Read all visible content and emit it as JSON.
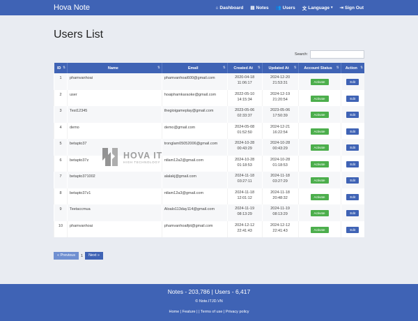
{
  "navbar": {
    "brand": "Hova Note",
    "items": [
      {
        "label": "Dashboard",
        "icon": "home-icon"
      },
      {
        "label": "Notes",
        "icon": "file-icon"
      },
      {
        "label": "Users",
        "icon": "users-icon"
      },
      {
        "label": "Language",
        "icon": "language-icon"
      },
      {
        "label": "Sign Out",
        "icon": "signout-icon"
      }
    ]
  },
  "page": {
    "title": "Users List"
  },
  "search": {
    "label": "Search:",
    "value": ""
  },
  "table": {
    "columns": [
      "ID",
      "Name",
      "Email",
      "Created At",
      "Updated At",
      "Account Status",
      "Action"
    ],
    "rows": [
      {
        "id": "1",
        "name": "phamvanhoai",
        "email": "phamvanhoai600@gmail.com",
        "created_date": "2020-04-18",
        "created_time": "11:06:17",
        "updated_date": "2024-12-20",
        "updated_time": "21:53:31",
        "status": "Activate",
        "action": "Edit"
      },
      {
        "id": "2",
        "name": "user",
        "email": "hoaiphamkaraoke@gmail.com",
        "created_date": "2022-05-10",
        "created_time": "14:15:34",
        "updated_date": "2024-12-19",
        "updated_time": "21:20:54",
        "status": "Activate",
        "action": "Edit"
      },
      {
        "id": "3",
        "name": "Test12345",
        "email": "thegioigameplay@gmail.com",
        "created_date": "2023-05-06",
        "created_time": "02:33:37",
        "updated_date": "2023-05-06",
        "updated_time": "17:50:39",
        "status": "Activate",
        "action": "Edit"
      },
      {
        "id": "4",
        "name": "demo",
        "email": "demo@gmail.com",
        "created_date": "2024-05-08",
        "created_time": "01:52:50",
        "updated_date": "2024-12-21",
        "updated_time": "16:22:54",
        "status": "Activate",
        "action": "Edit"
      },
      {
        "id": "5",
        "name": "betapto37",
        "email": "tronglam05052006@gmail.com",
        "created_date": "2024-10-28",
        "created_time": "00:43:29",
        "updated_date": "2024-10-28",
        "updated_time": "00:43:29",
        "status": "Activate",
        "action": "Edit"
      },
      {
        "id": "6",
        "name": "betapto37z",
        "email": "ntlam12a2@gmail.com",
        "created_date": "2024-10-28",
        "created_time": "01:18:53",
        "updated_date": "2024-10-28",
        "updated_time": "01:18:53",
        "status": "Activate",
        "action": "Edit"
      },
      {
        "id": "7",
        "name": "betapto371002",
        "email": "alalakj@gmail.com",
        "created_date": "2024-11-18",
        "created_time": "03:27:11",
        "updated_date": "2024-11-18",
        "updated_time": "03:27:29",
        "status": "Activate",
        "action": "Edit"
      },
      {
        "id": "8",
        "name": "betapto37z1",
        "email": "ntlam12a3@gmail.com",
        "created_date": "2024-11-18",
        "created_time": "12:01:12",
        "updated_date": "2024-11-18",
        "updated_time": "20:48:32",
        "status": "Activate",
        "action": "Edit"
      },
      {
        "id": "9",
        "name": "Teetaccmua",
        "email": "Aloalo113day114@gmail.com",
        "created_date": "2024-11-19",
        "created_time": "08:13:29",
        "updated_date": "2024-11-19",
        "updated_time": "08:13:29",
        "status": "Activate",
        "action": "Edit"
      },
      {
        "id": "10",
        "name": "phamvanhoai",
        "email": "phamvanhoaifpt@gmail.com",
        "created_date": "2024-12-12",
        "created_time": "22:41:43",
        "updated_date": "2024-12-12",
        "updated_time": "22:41:43",
        "status": "Activate",
        "action": "Edit"
      }
    ]
  },
  "pagination": {
    "prev": "« Previous",
    "current": "1",
    "next": "Next »"
  },
  "footer": {
    "stats": "Notes - 203,786 | Users - 6,417",
    "copyright": "© Note.ITJD.VN",
    "links": "Home | Feature | | Terms of use | Privacy policy"
  },
  "watermark": {
    "title": "HOVA IT",
    "subtitle": "HIGH TECHNOLOGY"
  },
  "colors": {
    "primary": "#3f63b5",
    "success": "#4cae4c",
    "background": "#e9ecf2"
  }
}
